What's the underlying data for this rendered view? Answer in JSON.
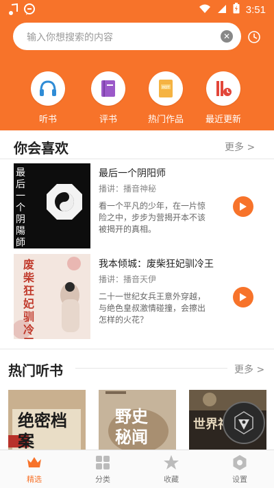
{
  "status_bar": {
    "time": "3:51"
  },
  "search": {
    "placeholder": "输入你想搜索的内容"
  },
  "quick_nav": [
    {
      "label": "听书",
      "icon": "headphones-icon"
    },
    {
      "label": "评书",
      "icon": "book-icon"
    },
    {
      "label": "热门作品",
      "icon": "hot-works-icon"
    },
    {
      "label": "最近更新",
      "icon": "recent-update-icon"
    }
  ],
  "recommend": {
    "title": "你会喜欢",
    "more": "更多 >",
    "books": [
      {
        "title": "最后一个阴阳师",
        "narrator": "播讲：播音神秘",
        "desc": "看一个平凡的少年，在一片惊险之中，步步为营揭开本不该被揭开的真相。",
        "cover_text": "最后一个阴陽師"
      },
      {
        "title": "我本倾城：废柴狂妃驯冷王",
        "narrator": "播讲：播音天伊",
        "desc": "二十一世纪女兵王意外穿越，与绝色皇叔激情碰撞，会擦出怎样的火花？",
        "cover_text": "废柴狂妃驯冷王"
      }
    ]
  },
  "hot": {
    "title": "热门听书",
    "more": "更多 >",
    "covers": [
      {
        "text": "绝密档案"
      },
      {
        "text": "野史秘闻"
      },
      {
        "text": "世界神秘"
      }
    ]
  },
  "tabs": [
    {
      "label": "精选",
      "active": true
    },
    {
      "label": "分类",
      "active": false
    },
    {
      "label": "收藏",
      "active": false
    },
    {
      "label": "设置",
      "active": false
    }
  ],
  "colors": {
    "accent": "#f7732a"
  }
}
